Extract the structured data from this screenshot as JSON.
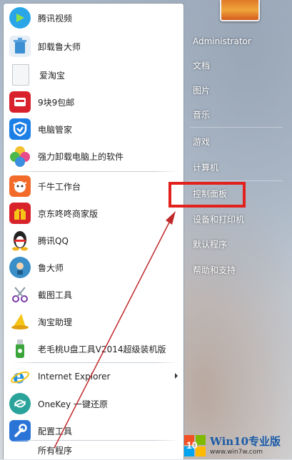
{
  "programs": [
    {
      "label": "腾讯视频",
      "icon": "tencent-video-icon",
      "color": "#2aa6e8"
    },
    {
      "label": "卸载鲁大师",
      "icon": "uninstall-icon",
      "color": "#3b8fd3"
    },
    {
      "label": "爱淘宝",
      "icon": "document-icon",
      "color": "#e8eaec"
    },
    {
      "label": "9块9包邮",
      "icon": "tmall-icon",
      "color": "#d9212b"
    },
    {
      "label": "电脑管家",
      "icon": "shield-icon",
      "color": "#1b7fe6"
    },
    {
      "label": "强力卸载电脑上的软件",
      "icon": "colorful-flower-icon",
      "color": "#4db84a"
    },
    {
      "label": "千牛工作台",
      "icon": "cow-icon",
      "color": "#f26b2b"
    },
    {
      "label": "京东咚咚商家版",
      "icon": "gift-box-icon",
      "color": "#d8232a"
    },
    {
      "label": "腾讯QQ",
      "icon": "qq-penguin-icon",
      "color": "#222222"
    },
    {
      "label": "鲁大师",
      "icon": "master-lu-icon",
      "color": "#3a8fc8"
    },
    {
      "label": "截图工具",
      "icon": "scissors-icon",
      "color": "#c8ccd2"
    },
    {
      "label": "淘宝助理",
      "icon": "wizard-hat-icon",
      "color": "#f5c518"
    },
    {
      "label": "老毛桃U盘工具V2014超级装机版",
      "icon": "usb-drive-icon",
      "color": "#3aa43a"
    },
    {
      "label": "Internet Explorer",
      "icon": "ie-icon",
      "color": "#1f8fe0"
    },
    {
      "label": "OneKey 一键还原",
      "icon": "onekey-icon",
      "color": "#2aa39a"
    },
    {
      "label": "配置工具",
      "icon": "wrench-icon",
      "color": "#2a74d8"
    }
  ],
  "all_programs": "所有程序",
  "user": "Administrator",
  "right_items": {
    "documents": "文档",
    "pictures": "图片",
    "music": "音乐",
    "games": "游戏",
    "computer": "计算机",
    "control_panel": "控制面板",
    "devices": "设备和打印机",
    "default_programs": "默认程序",
    "help": "帮助和支持"
  },
  "watermark": {
    "title": "Win10专业版",
    "url": "www.win7w.com",
    "logo_text": "10"
  },
  "colors": {
    "highlight": "#e2211c",
    "arrow": "#c0282a"
  }
}
